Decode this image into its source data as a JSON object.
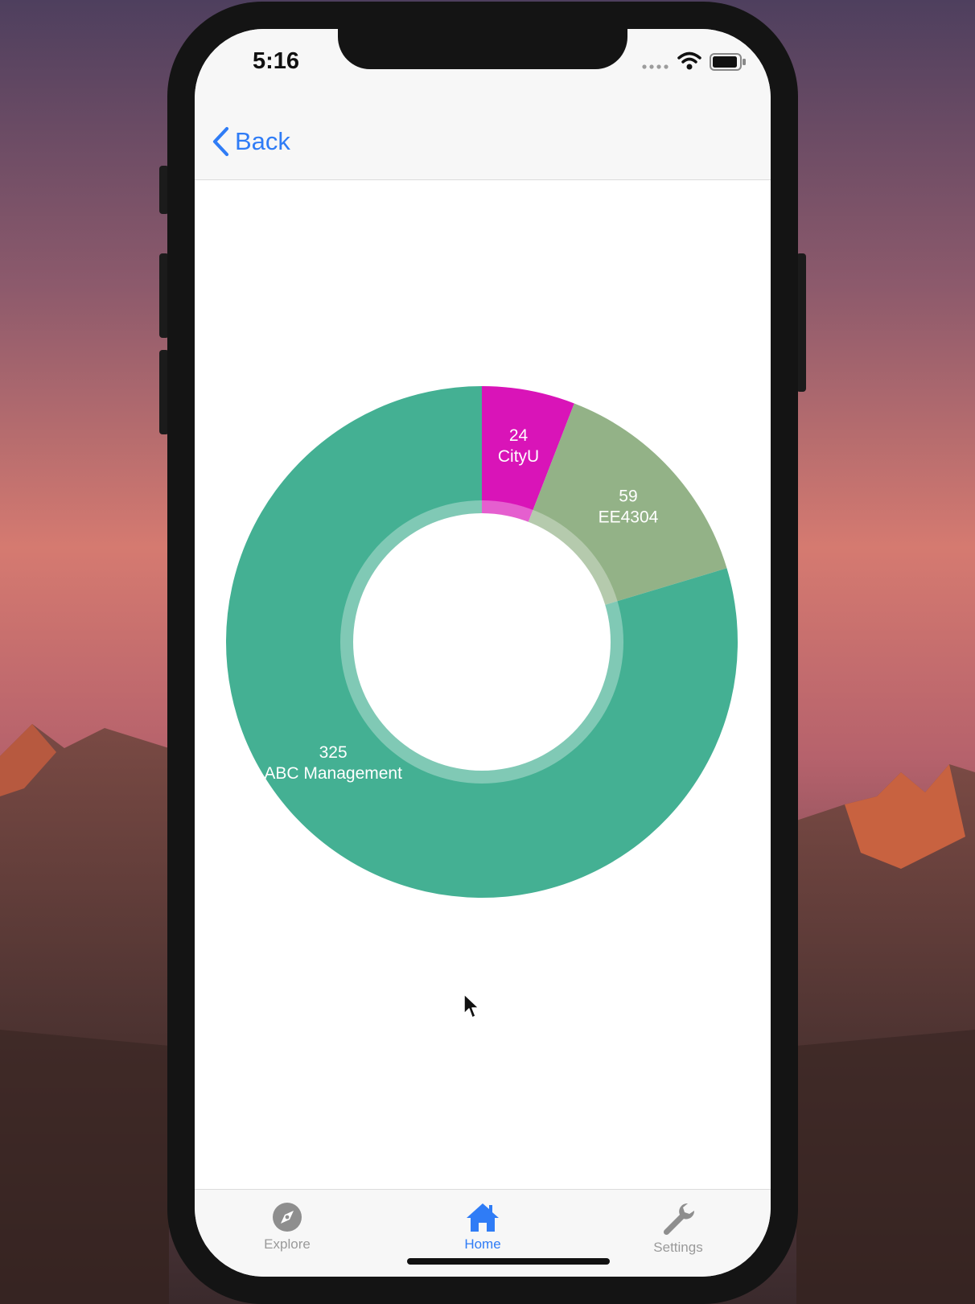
{
  "status_bar": {
    "time": "5:16"
  },
  "nav_bar": {
    "back_label": "Back"
  },
  "chart_data": {
    "type": "pie",
    "variant": "donut",
    "slices": [
      {
        "label": "CityU",
        "value": 24,
        "color": "#d914b8"
      },
      {
        "label": "EE4304",
        "value": 59,
        "color": "#93b287"
      },
      {
        "label": "ABC Management",
        "value": 325,
        "color": "#44b093"
      }
    ],
    "slice_texts": [
      "24\nCityU",
      "59\nEE4304",
      "325\nABC Management"
    ]
  },
  "tab_bar": {
    "tabs": [
      {
        "label": "Explore",
        "icon": "compass-icon",
        "selected": false
      },
      {
        "label": "Home",
        "icon": "home-icon",
        "selected": true
      },
      {
        "label": "Settings",
        "icon": "wrench-icon",
        "selected": false
      }
    ]
  },
  "colors": {
    "accent": "#2f7cf6",
    "tab_inactive": "#9a9a9a",
    "bar_background": "#f7f7f7"
  }
}
